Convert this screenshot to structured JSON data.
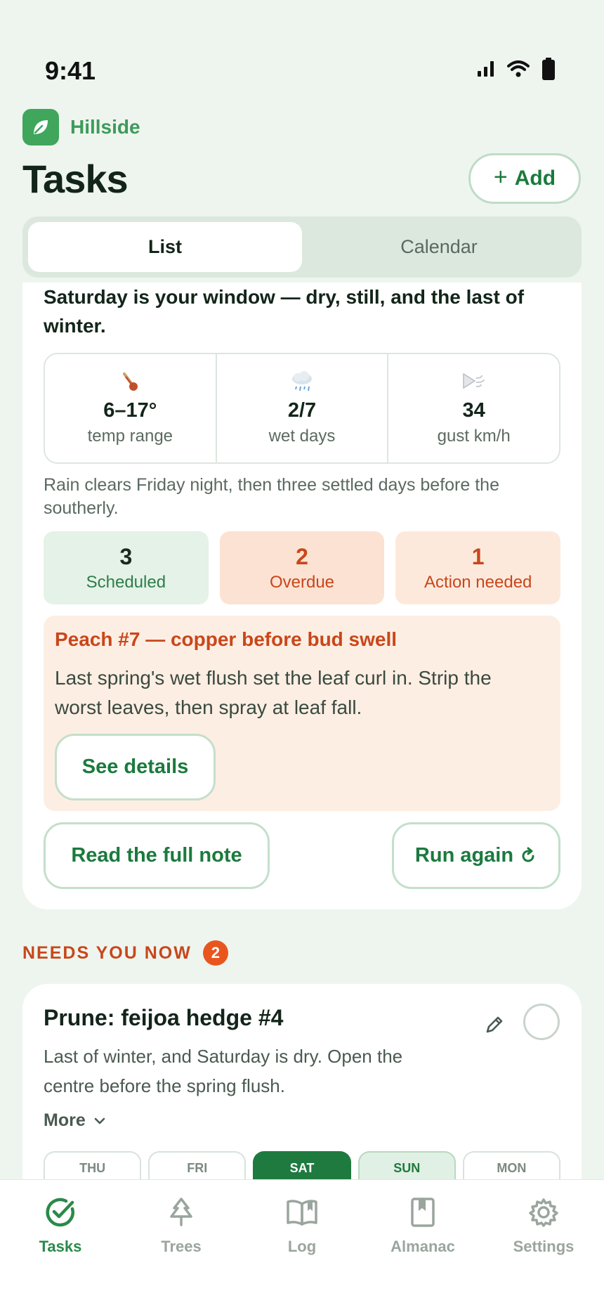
{
  "status": {
    "time": "9:41"
  },
  "brand": {
    "name": "Hillside"
  },
  "header": {
    "title": "Tasks",
    "add_label": "Add"
  },
  "view_toggle": {
    "options": [
      "List",
      "Calendar"
    ],
    "selected": "List"
  },
  "summary": {
    "headline": "Saturday is your window — dry, still, and the last of winter.",
    "stats": [
      {
        "icon": "thermometer-icon",
        "value": "6–17°",
        "label": "temp range"
      },
      {
        "icon": "rain-cloud-icon",
        "value": "2/7",
        "label": "wet days"
      },
      {
        "icon": "wind-icon",
        "value": "34",
        "label": "gust km/h"
      }
    ],
    "forecast": "Rain clears Friday night, then three settled days before the southerly.",
    "counts": [
      {
        "num": "3",
        "label": "Scheduled"
      },
      {
        "num": "2",
        "label": "Overdue"
      },
      {
        "num": "1",
        "label": "Action needed"
      }
    ],
    "alert": {
      "title": "Peach #7 — copper before bud swell",
      "body": "Last spring's wet flush set the leaf curl in. Strip the worst leaves, then spray at leaf fall.",
      "button": "See details"
    },
    "read_note": "Read the full note",
    "run_again": "Run again"
  },
  "needs_now": {
    "title": "NEEDS YOU NOW",
    "badge": "2",
    "task": {
      "title": "Prune: feijoa hedge #4",
      "description": "Last of winter, and Saturday is dry. Open the centre before the spring flush.",
      "more": "More",
      "days": [
        "THU",
        "FRI",
        "SAT",
        "SUN",
        "MON"
      ],
      "selected_day": "SAT"
    }
  },
  "tabs": [
    {
      "label": "Tasks",
      "icon": "check-circle-icon",
      "active": true
    },
    {
      "label": "Trees",
      "icon": "tree-icon"
    },
    {
      "label": "Log",
      "icon": "book-icon"
    },
    {
      "label": "Almanac",
      "icon": "bookmark-book-icon"
    },
    {
      "label": "Settings",
      "icon": "gear-icon"
    }
  ],
  "colors": {
    "accent": "#1b7a3d",
    "warning": "#c8471a",
    "background": "#eef5ef"
  }
}
